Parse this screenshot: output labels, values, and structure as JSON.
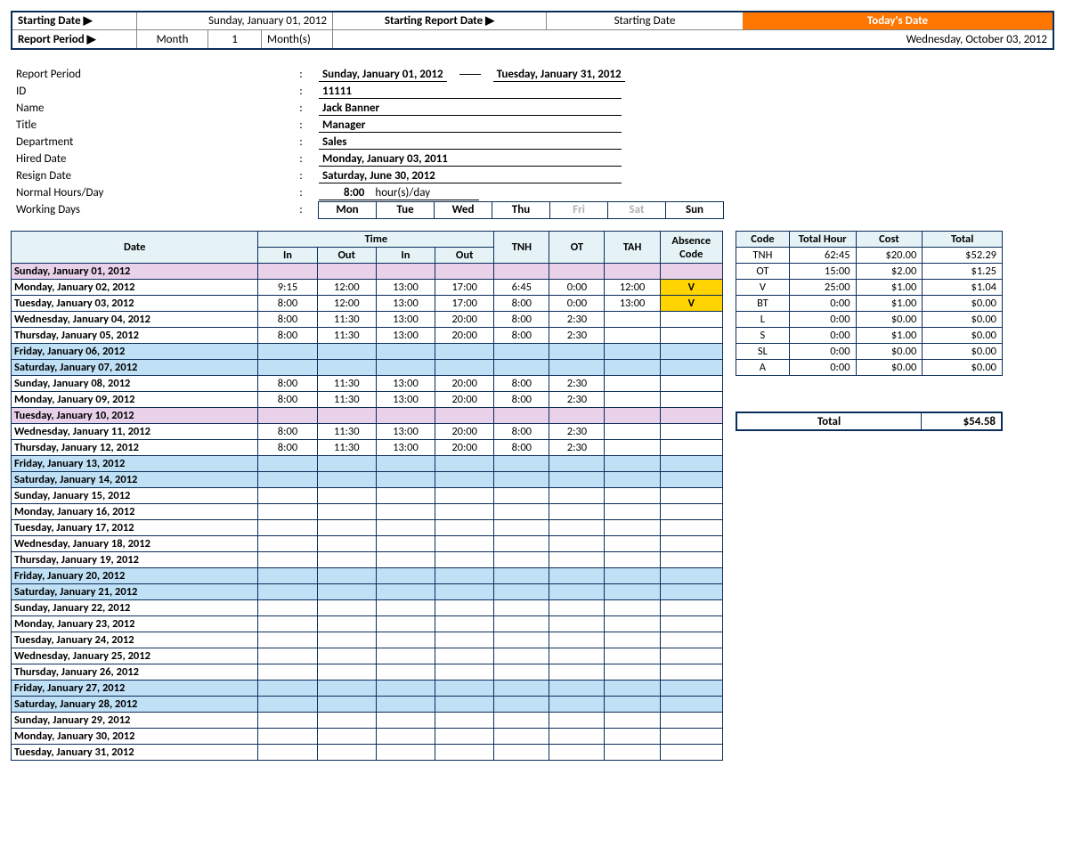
{
  "topbar": {
    "starting_date_label": "Starting Date ▶",
    "starting_date_value": "Sunday, January 01, 2012",
    "starting_report_date_label": "Starting Report Date ▶",
    "starting_report_date_value": "Starting Date",
    "report_period_label": "Report Period ▶",
    "report_period_unit": "Month",
    "report_period_qty": "1",
    "report_period_suffix": "Month(s)",
    "todays_date_label": "Today's Date",
    "todays_date_value": "Wednesday, October 03, 2012"
  },
  "info": {
    "report_period_label": "Report Period",
    "report_period_from": "Sunday, January 01, 2012",
    "report_period_to": "Tuesday, January 31, 2012",
    "id_label": "ID",
    "id_value": "11111",
    "name_label": "Name",
    "name_value": "Jack Banner",
    "title_label": "Title",
    "title_value": "Manager",
    "department_label": "Department",
    "department_value": "Sales",
    "hired_label": "Hired Date",
    "hired_value": "Monday, January 03, 2011",
    "resign_label": "Resign Date",
    "resign_value": "Saturday, June 30, 2012",
    "hours_label": "Normal Hours/Day",
    "hours_value": "8:00",
    "hours_suffix": "hour(s)/day",
    "wd_label": "Working Days",
    "wd_days": [
      "Mon",
      "Tue",
      "Wed",
      "Thu",
      "Fri",
      "Sat",
      "Sun"
    ],
    "wd_off": [
      false,
      false,
      false,
      false,
      true,
      true,
      false
    ]
  },
  "ts_headers": {
    "date": "Date",
    "time": "Time",
    "in": "In",
    "out": "Out",
    "tnh": "TNH",
    "ot": "OT",
    "tah": "TAH",
    "abs": "Absence Code"
  },
  "rows": [
    {
      "date": "Sunday, January 01, 2012",
      "cls": "pink"
    },
    {
      "date": "Monday, January 02, 2012",
      "in1": "9:15",
      "out1": "12:00",
      "in2": "13:00",
      "out2": "17:00",
      "tnh": "6:45",
      "ot": "0:00",
      "tah": "12:00",
      "abs": "V"
    },
    {
      "date": "Tuesday, January 03, 2012",
      "in1": "8:00",
      "out1": "12:00",
      "in2": "13:00",
      "out2": "17:00",
      "tnh": "8:00",
      "ot": "0:00",
      "tah": "13:00",
      "abs": "V"
    },
    {
      "date": "Wednesday, January 04, 2012",
      "in1": "8:00",
      "out1": "11:30",
      "in2": "13:00",
      "out2": "20:00",
      "tnh": "8:00",
      "ot": "2:30"
    },
    {
      "date": "Thursday, January 05, 2012",
      "in1": "8:00",
      "out1": "11:30",
      "in2": "13:00",
      "out2": "20:00",
      "tnh": "8:00",
      "ot": "2:30"
    },
    {
      "date": "Friday, January 06, 2012",
      "cls": "weekend"
    },
    {
      "date": "Saturday, January 07, 2012",
      "cls": "weekend"
    },
    {
      "date": "Sunday, January 08, 2012",
      "in1": "8:00",
      "out1": "11:30",
      "in2": "13:00",
      "out2": "20:00",
      "tnh": "8:00",
      "ot": "2:30"
    },
    {
      "date": "Monday, January 09, 2012",
      "in1": "8:00",
      "out1": "11:30",
      "in2": "13:00",
      "out2": "20:00",
      "tnh": "8:00",
      "ot": "2:30"
    },
    {
      "date": "Tuesday, January 10, 2012",
      "cls": "pink"
    },
    {
      "date": "Wednesday, January 11, 2012",
      "in1": "8:00",
      "out1": "11:30",
      "in2": "13:00",
      "out2": "20:00",
      "tnh": "8:00",
      "ot": "2:30"
    },
    {
      "date": "Thursday, January 12, 2012",
      "in1": "8:00",
      "out1": "11:30",
      "in2": "13:00",
      "out2": "20:00",
      "tnh": "8:00",
      "ot": "2:30"
    },
    {
      "date": "Friday, January 13, 2012",
      "cls": "weekend"
    },
    {
      "date": "Saturday, January 14, 2012",
      "cls": "weekend"
    },
    {
      "date": "Sunday, January 15, 2012"
    },
    {
      "date": "Monday, January 16, 2012"
    },
    {
      "date": "Tuesday, January 17, 2012"
    },
    {
      "date": "Wednesday, January 18, 2012"
    },
    {
      "date": "Thursday, January 19, 2012"
    },
    {
      "date": "Friday, January 20, 2012",
      "cls": "weekend"
    },
    {
      "date": "Saturday, January 21, 2012",
      "cls": "weekend"
    },
    {
      "date": "Sunday, January 22, 2012"
    },
    {
      "date": "Monday, January 23, 2012"
    },
    {
      "date": "Tuesday, January 24, 2012"
    },
    {
      "date": "Wednesday, January 25, 2012"
    },
    {
      "date": "Thursday, January 26, 2012"
    },
    {
      "date": "Friday, January 27, 2012",
      "cls": "weekend"
    },
    {
      "date": "Saturday, January 28, 2012",
      "cls": "weekend"
    },
    {
      "date": "Sunday, January 29, 2012"
    },
    {
      "date": "Monday, January 30, 2012"
    },
    {
      "date": "Tuesday, January 31, 2012"
    }
  ],
  "summary_headers": {
    "code": "Code",
    "th": "Total Hour",
    "cost": "Cost",
    "total": "Total"
  },
  "summary": [
    {
      "code": "TNH",
      "th": "62:45",
      "cost": "$20.00",
      "total": "$52.29"
    },
    {
      "code": "OT",
      "th": "15:00",
      "cost": "$2.00",
      "total": "$1.25"
    },
    {
      "code": "V",
      "th": "25:00",
      "cost": "$1.00",
      "total": "$1.04"
    },
    {
      "code": "BT",
      "th": "0:00",
      "cost": "$1.00",
      "total": "$0.00"
    },
    {
      "code": "L",
      "th": "0:00",
      "cost": "$0.00",
      "total": "$0.00"
    },
    {
      "code": "S",
      "th": "0:00",
      "cost": "$1.00",
      "total": "$0.00"
    },
    {
      "code": "SL",
      "th": "0:00",
      "cost": "$0.00",
      "total": "$0.00"
    },
    {
      "code": "A",
      "th": "0:00",
      "cost": "$0.00",
      "total": "$0.00"
    }
  ],
  "grand_total_label": "Total",
  "grand_total_value": "$54.58"
}
